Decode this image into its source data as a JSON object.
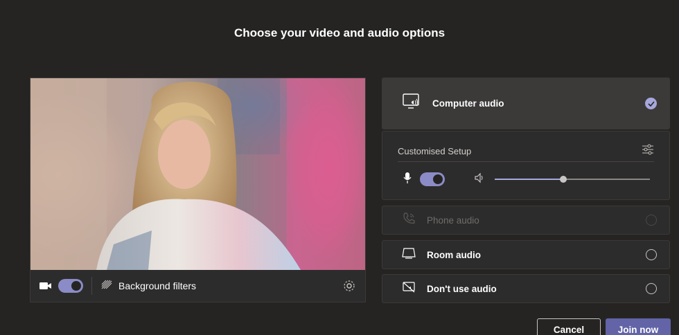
{
  "header": {
    "title": "Choose your video and audio options"
  },
  "video": {
    "camera_on": true,
    "background_filters_label": "Background filters"
  },
  "audio_options": {
    "computer_audio": {
      "label": "Computer audio",
      "selected": true
    },
    "customised_setup": {
      "title": "Customised Setup",
      "mic_on": true,
      "speaker_volume_fraction": 0.44
    },
    "phone_audio": {
      "label": "Phone audio",
      "enabled": false
    },
    "room_audio": {
      "label": "Room audio"
    },
    "no_audio": {
      "label": "Don't use audio"
    }
  },
  "footer": {
    "cancel_label": "Cancel",
    "join_label": "Join now"
  },
  "colors": {
    "accent": "#6264a7",
    "accent_light": "#a6a7dc",
    "background": "#252423",
    "panel": "#2d2c2c"
  }
}
